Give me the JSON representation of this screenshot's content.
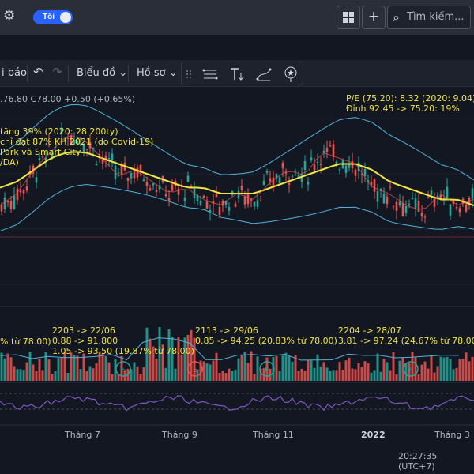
{
  "header": {
    "theme_toggle_label": "Tối",
    "search_placeholder": "Tìm kiếm..."
  },
  "toolbar": {
    "alerts_label": "i báo",
    "chart_menu_label": "Biểu đồ",
    "profile_menu_label": "Hồ sơ"
  },
  "legend": {
    "ohlc": ".76.80 C78.00 +0.50 (+0.65%)",
    "pe": "P/E (75.20): 8.32 (2020: 9.04)",
    "peak": "Đỉnh 92.45 -> 75.20: 19%"
  },
  "notes": [
    "tăng 39% (2020: 28.200ty)",
    "chỉ đạt 87% KH 2021 (do Covid-19)",
    "Park và Smart City",
    "/DA)"
  ],
  "annotations": [
    {
      "lines": [
        "% từ 78.00)"
      ]
    },
    {
      "lines": [
        "2203 -> 22/06",
        "0.88 -> 91.800",
        "1.05 -> 93.50 (19.87% từ 78.00)"
      ]
    },
    {
      "lines": [
        "2113 -> 29/06",
        "0.85 -> 94.25 (20.83% từ 78.00)"
      ]
    },
    {
      "lines": [
        "2204 -> 28/07",
        "3.81 -> 97.24 (24.67% từ 78.00)"
      ]
    }
  ],
  "signals": [
    {
      "letter": "F",
      "color": "#26a69a"
    },
    {
      "letter": "S",
      "color": "#ef5350"
    },
    {
      "letter": "F",
      "color": "#26a69a"
    },
    {
      "letter": "F",
      "color": "#26a69a"
    }
  ],
  "x_axis": [
    "Tháng 7",
    "Tháng 9",
    "Tháng 11",
    "2022",
    "Tháng 3"
  ],
  "clock": "20:27:35 (UTC+7)",
  "colors": {
    "up": "#26a69a",
    "down": "#ef5350",
    "ma": "#f0e442",
    "bollinger": "#4fb3d9",
    "rsi": "#7e57c2"
  },
  "chart_data": {
    "type": "line",
    "title": "",
    "price_series": {
      "name": "",
      "values": [
        80,
        82,
        86,
        89,
        92,
        91,
        88,
        85,
        86,
        84,
        82,
        83,
        81,
        80,
        82,
        81,
        84,
        86,
        85,
        89,
        88,
        87,
        83,
        82,
        80,
        79,
        82,
        80,
        81
      ]
    },
    "ma_series": {
      "name": "",
      "values": [
        83,
        84,
        86,
        88,
        89,
        89,
        88,
        87,
        86,
        85,
        84,
        83,
        83,
        82,
        82,
        82,
        83,
        84,
        85,
        86,
        87,
        87,
        86,
        84,
        83,
        82,
        81,
        81,
        80
      ]
    }
  }
}
